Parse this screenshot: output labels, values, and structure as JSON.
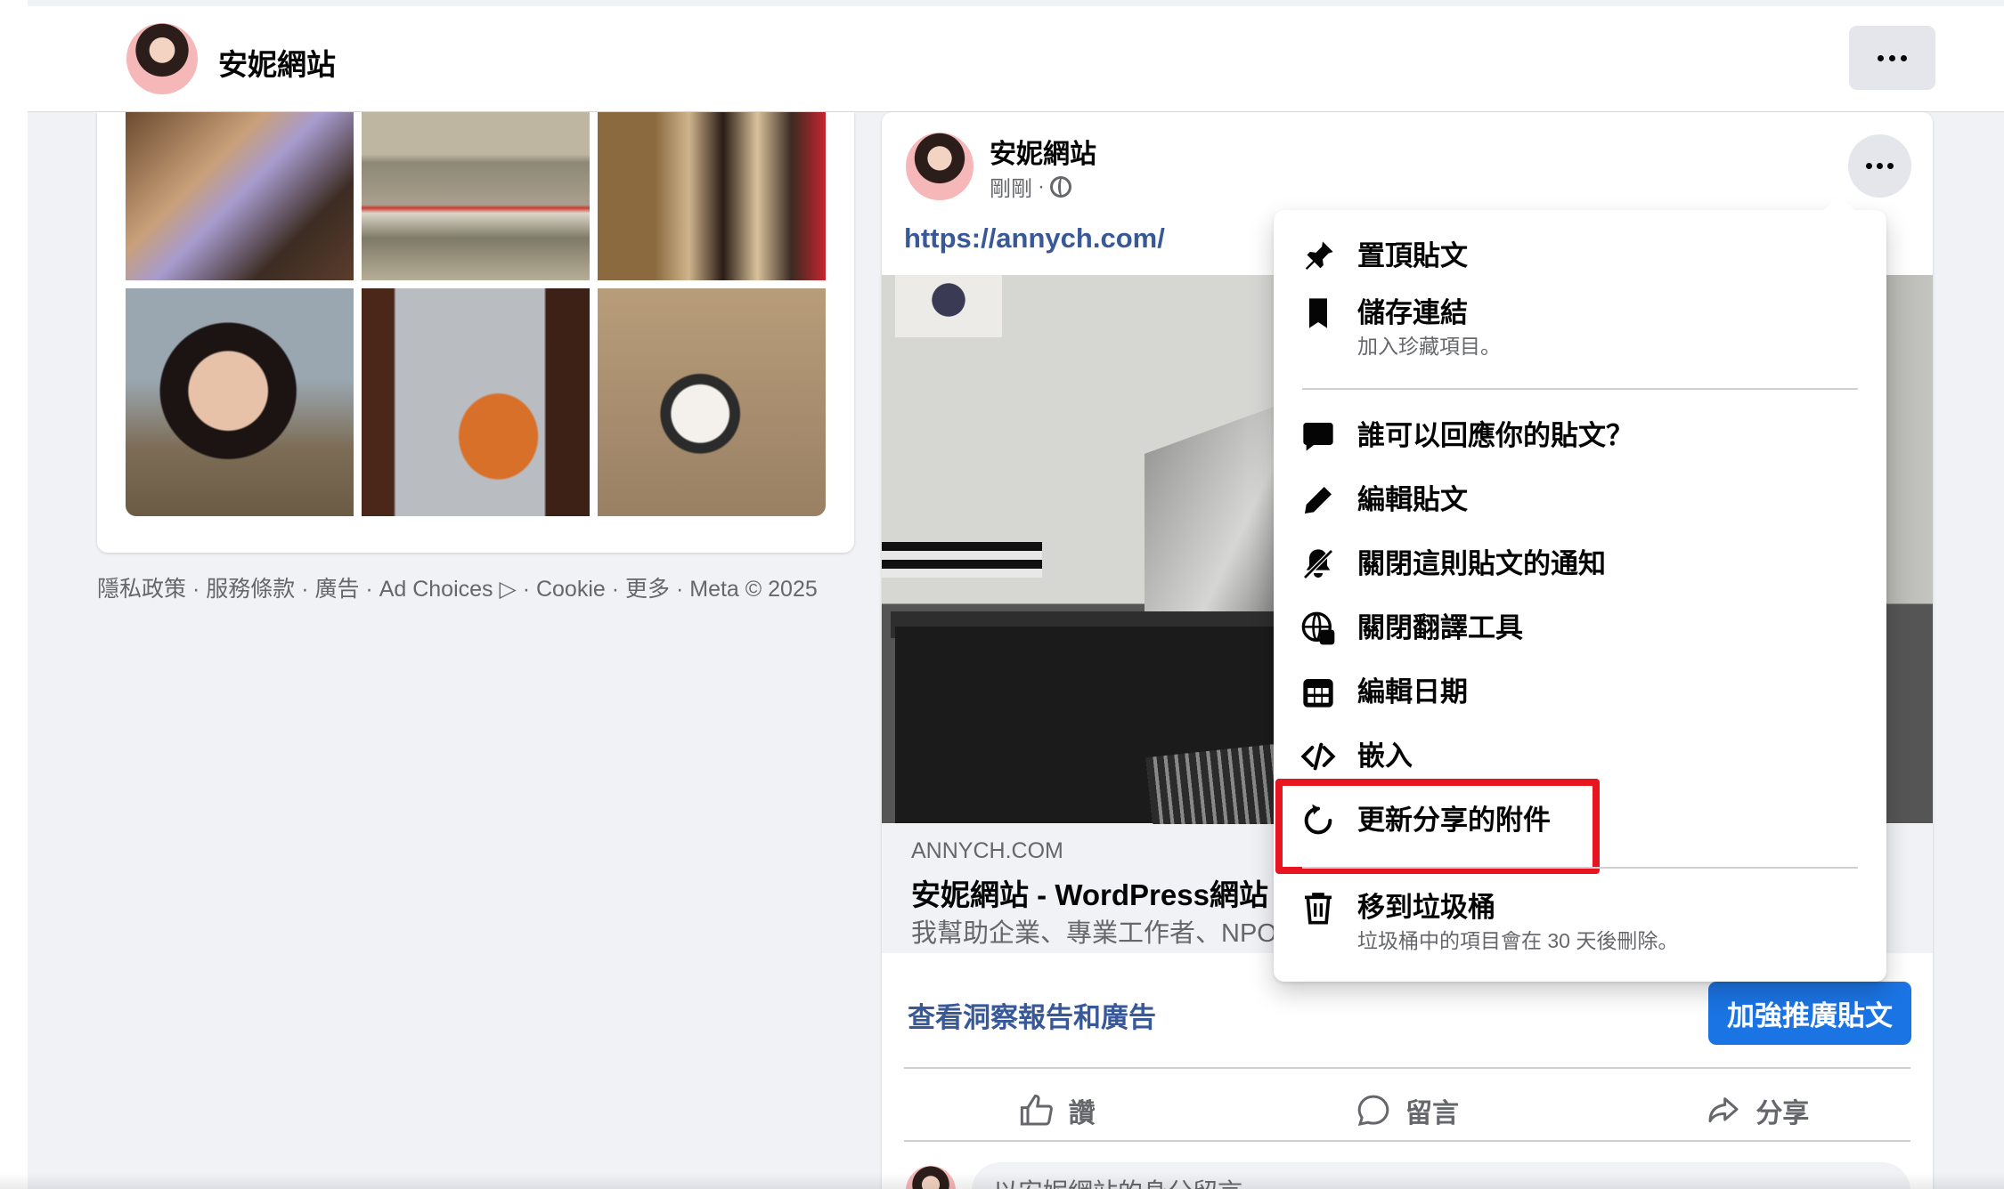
{
  "header": {
    "page_name": "安妮網站"
  },
  "footer": {
    "links": [
      "隱私政策",
      "服務條款",
      "廣告",
      "Ad Choices",
      "Cookie",
      "更多"
    ],
    "sep": " · ",
    "copyright": "Meta © 2025"
  },
  "post": {
    "author": "安妮網站",
    "time": "剛剛",
    "time_sep": "·",
    "link": "https://annych.com/",
    "preview_domain": "ANNYCH.COM",
    "preview_title": "安妮網站 - WordPress網站",
    "preview_desc": "我幫助企業、專業工作者、NPO",
    "insights_link": "查看洞察報告和廣告",
    "boost_button": "加強推廣貼文",
    "actions": {
      "like": "讚",
      "comment": "留言",
      "share": "分享"
    },
    "comment_placeholder": "以安妮網站的身分留言"
  },
  "menu": {
    "items": [
      {
        "label": "置頂貼文",
        "icon": "pin-icon"
      },
      {
        "label": "儲存連結",
        "sub": "加入珍藏項目。",
        "icon": "bookmark-icon"
      },
      {
        "label": "誰可以回應你的貼文？",
        "icon": "speech-bubble-icon"
      },
      {
        "label": "編輯貼文",
        "icon": "pencil-icon"
      },
      {
        "label": "關閉這則貼文的通知",
        "icon": "bell-off-icon"
      },
      {
        "label": "關閉翻譯工具",
        "icon": "translate-globe-icon"
      },
      {
        "label": "編輯日期",
        "icon": "calendar-icon"
      },
      {
        "label": "嵌入",
        "icon": "code-icon"
      },
      {
        "label": "更新分享的附件",
        "icon": "refresh-icon"
      },
      {
        "label": "移到垃圾桶",
        "sub": "垃圾桶中的項目會在 30 天後刪除。",
        "icon": "trash-icon"
      }
    ],
    "highlight_color": "#e8141f"
  },
  "colors": {
    "link_blue": "#385898",
    "primary_button": "#1b74e4",
    "page_bg": "#f0f2f5"
  }
}
